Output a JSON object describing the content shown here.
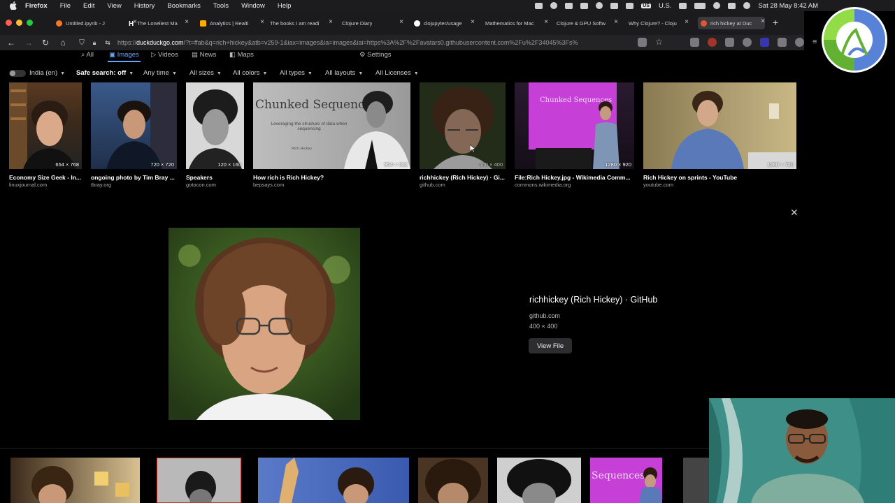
{
  "menubar": {
    "app_name": "Firefox",
    "items": [
      "File",
      "Edit",
      "View",
      "History",
      "Bookmarks",
      "Tools",
      "Window",
      "Help"
    ],
    "input_source": "U.S.",
    "clock": "Sat 28 May  8:42 AM"
  },
  "tabs": [
    {
      "label": "Untitled.ipynb - J",
      "color": "#f37726"
    },
    {
      "label": "The Loneliest Ma",
      "color": "#ffffff"
    },
    {
      "label": "Analytics | Realti",
      "color": "#f9ab00"
    },
    {
      "label": "The books I am readi",
      "color": ""
    },
    {
      "label": "Clojure Diary",
      "color": ""
    },
    {
      "label": "clojupyter/usage",
      "color": "#ffffff"
    },
    {
      "label": "Mathematics for Mac",
      "color": ""
    },
    {
      "label": "Clojure & GPU Softw",
      "color": ""
    },
    {
      "label": "Why Clojure? - Cloju",
      "color": ""
    },
    {
      "label": "rich hickey at Duc",
      "color": "#de5833"
    }
  ],
  "navbar": {
    "url_prefix": "https://",
    "url_host": "duckduckgo.com",
    "url_rest": "/?t=ffab&q=rich+hickey&atb=v259-1&iax=images&ia=images&iai=https%3A%2F%2Favatars0.githubusercontent.com%2Fu%2F34045%3Fs%"
  },
  "ddg_tabs": {
    "all": "All",
    "images": "Images",
    "videos": "Videos",
    "news": "News",
    "maps": "Maps",
    "settings": "Settings"
  },
  "filters": {
    "region": "India (en)",
    "safe_search": "Safe search: off",
    "time": "Any time",
    "sizes": "All sizes",
    "colors": "All colors",
    "types": "All types",
    "layouts": "All layouts",
    "licenses": "All Licenses"
  },
  "results": [
    {
      "title": "Economy Size Geek - In...",
      "source": "linuxjournal.com",
      "dims": "654 × 768"
    },
    {
      "title": "ongoing photo by Tim Bray ...",
      "source": "tbray.org",
      "dims": "720 × 720"
    },
    {
      "title": "Speakers",
      "source": "gotocon.com",
      "dims": "120 × 160"
    },
    {
      "title": "How rich is Rich Hickey?",
      "source": "bepsays.com",
      "dims": "954 × 522",
      "slide_title": "Chunked Sequences",
      "slide_sub": "Leveraging the structure of data when sequencing",
      "slide_author": "Rich Hickey"
    },
    {
      "title": "richhickey (Rich Hickey) · Gi...",
      "source": "github.com",
      "dims": "400 × 400"
    },
    {
      "title": "File:Rich Hickey.jpg - Wikimedia Comm...",
      "source": "commons.wikimedia.org",
      "dims": "1280 × 920",
      "slide_title": "Chunked Sequences"
    },
    {
      "title": "Rich Hickey on sprints - YouTube",
      "source": "youtube.com",
      "dims": "1280 × 720"
    }
  ],
  "detail": {
    "title": "richhickey (Rich Hickey) · GitHub",
    "source": "github.com",
    "dims": "400 × 400",
    "view_file": "View File"
  },
  "bottom_row": {
    "slide_fragment": "Sequences"
  }
}
